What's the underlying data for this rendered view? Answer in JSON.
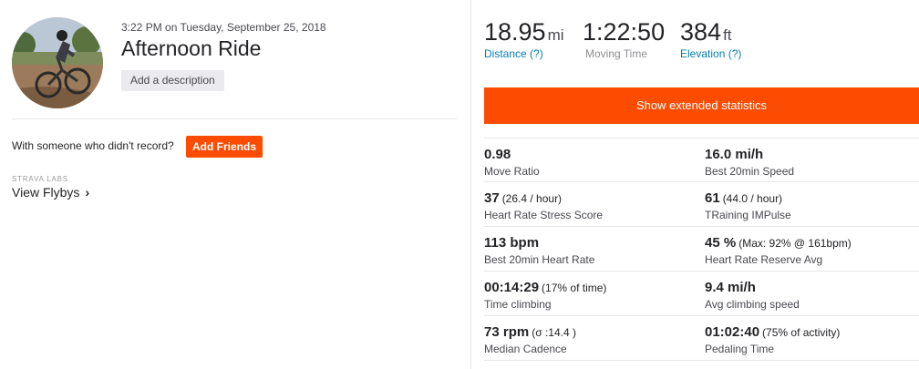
{
  "activity": {
    "datetime": "3:22 PM on Tuesday, September 25, 2018",
    "title": "Afternoon Ride",
    "add_description": "Add a description"
  },
  "friends": {
    "prompt": "With someone who didn't record?",
    "button": "Add Friends"
  },
  "labs": {
    "label": "STRAVA LABS",
    "link": "View Flybys"
  },
  "summary": [
    {
      "value": "18.95",
      "unit": "mi",
      "label": "Distance (?)",
      "link": true
    },
    {
      "value": "1:22:50",
      "unit": "",
      "label": "Moving Time",
      "link": false
    },
    {
      "value": "384",
      "unit": "ft",
      "label": "Elevation (?)",
      "link": true
    }
  ],
  "extended_button": "Show extended statistics",
  "stats": [
    [
      {
        "value": "0.98",
        "extra": "",
        "label": "Move Ratio"
      },
      {
        "value": "16.0 mi/h",
        "extra": "",
        "label": "Best 20min Speed"
      }
    ],
    [
      {
        "value": "37",
        "extra": "(26.4 / hour)",
        "label": "Heart Rate Stress Score"
      },
      {
        "value": "61",
        "extra": "(44.0 / hour)",
        "label": "TRaining IMPulse"
      }
    ],
    [
      {
        "value": "113 bpm",
        "extra": "",
        "label": "Best 20min Heart Rate"
      },
      {
        "value": "45 %",
        "extra": "(Max: 92% @ 161bpm)",
        "label": "Heart Rate Reserve Avg"
      }
    ],
    [
      {
        "value": "00:14:29",
        "extra": "(17% of time)",
        "label": "Time climbing"
      },
      {
        "value": "9.4 mi/h",
        "extra": "",
        "label": "Avg climbing speed"
      }
    ],
    [
      {
        "value": "73 rpm",
        "extra": "(σ :14.4 )",
        "label": "Median Cadence"
      },
      {
        "value": "01:02:40",
        "extra": "(75% of activity)",
        "label": "Pedaling Time"
      }
    ]
  ],
  "colors": {
    "accent": "#fc4c02",
    "link": "#007fb6"
  }
}
